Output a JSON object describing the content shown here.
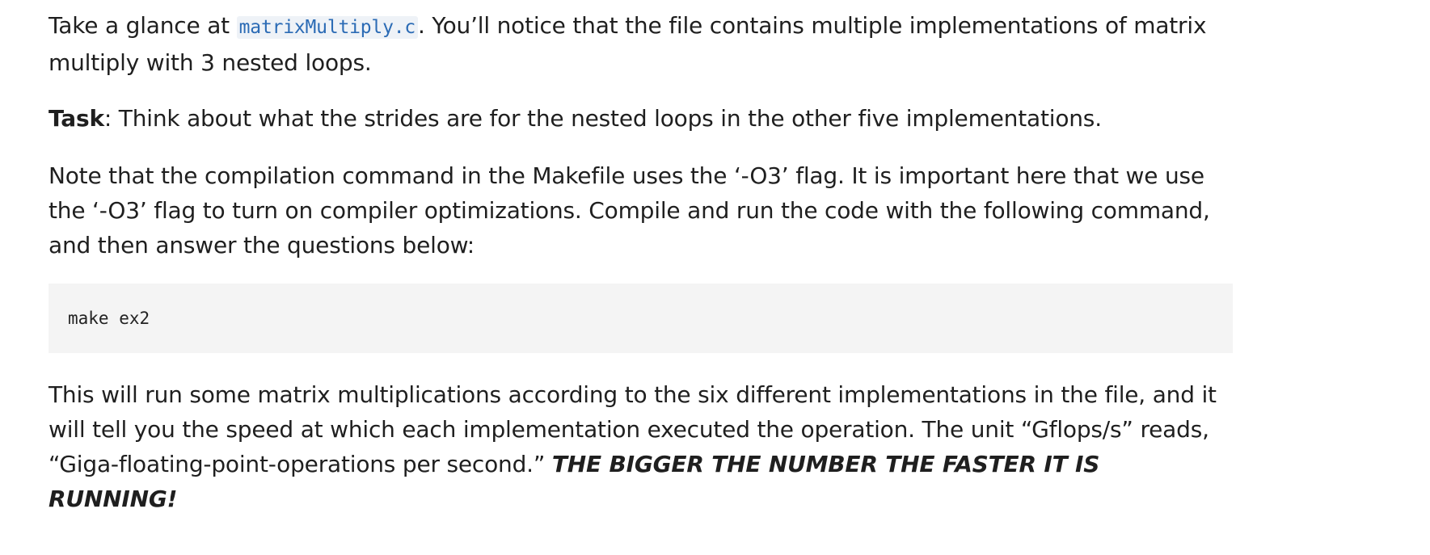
{
  "paragraph1": {
    "prefix": "Take a glance at ",
    "code": "matrixMultiply.c",
    "suffix": ". You’ll notice that the file contains multiple implementations of matrix multiply with 3 nested loops."
  },
  "paragraph2": {
    "bold": "Task",
    "text": ": Think about what the strides are for the nested loops in the other five implementations."
  },
  "paragraph3": {
    "text": "Note that the compilation command in the Makefile uses the ‘-O3’ flag. It is important here that we use the ‘-O3’ flag to turn on compiler optimizations. Compile and run the code with the following command, and then answer the questions below:"
  },
  "code_block": {
    "command": "make ex2"
  },
  "paragraph4": {
    "text": "This will run some matrix multiplications according to the six different implementations in the file, and it will tell you the speed at which each implementation executed the operation. The unit “Gflops/s” reads, “Giga-floating-point-operations per second.” ",
    "emphasis": "THE BIGGER THE NUMBER THE FASTER IT IS RUNNING!"
  }
}
